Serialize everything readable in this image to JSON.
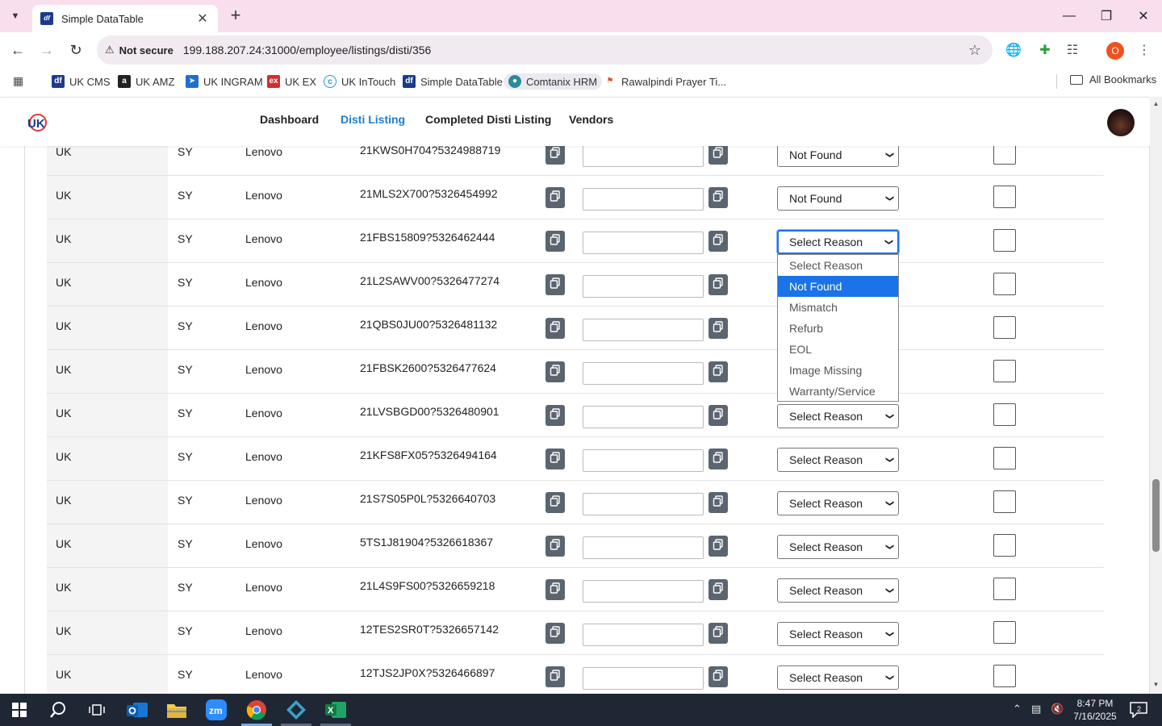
{
  "browser": {
    "tab_title": "Simple DataTable",
    "security_label": "Not secure",
    "url": "199.188.207.24:31000/employee/listings/disti/356",
    "profile_initial": "O",
    "bookmarks": [
      "UK CMS",
      "UK AMZ",
      "UK INGRAM",
      "UK EX",
      "UK InTouch",
      "Simple DataTable",
      "Comtanix HRM",
      "Rawalpindi Prayer Ti..."
    ],
    "all_bookmarks": "All Bookmarks"
  },
  "nav": {
    "links": [
      "Dashboard",
      "Disti Listing",
      "Completed Disti Listing",
      "Vendors"
    ],
    "active": "Disti Listing"
  },
  "table": {
    "rows": [
      {
        "region": "UK",
        "code": "SY",
        "brand": "Lenovo",
        "product": "21KWS0H704?5324988719",
        "reason": "Not Found"
      },
      {
        "region": "UK",
        "code": "SY",
        "brand": "Lenovo",
        "product": "21MLS2X700?5326454992",
        "reason": "Not Found"
      },
      {
        "region": "UK",
        "code": "SY",
        "brand": "Lenovo",
        "product": "21FBS15809?5326462444",
        "reason": "Select Reason"
      },
      {
        "region": "UK",
        "code": "SY",
        "brand": "Lenovo",
        "product": "21L2SAWV00?5326477274",
        "reason": "Select Reason"
      },
      {
        "region": "UK",
        "code": "SY",
        "brand": "Lenovo",
        "product": "21QBS0JU00?5326481132",
        "reason": "Select Reason"
      },
      {
        "region": "UK",
        "code": "SY",
        "brand": "Lenovo",
        "product": "21FBSK2600?5326477624",
        "reason": "Select Reason"
      },
      {
        "region": "UK",
        "code": "SY",
        "brand": "Lenovo",
        "product": "21LVSBGD00?5326480901",
        "reason": "Select Reason"
      },
      {
        "region": "UK",
        "code": "SY",
        "brand": "Lenovo",
        "product": "21KFS8FX05?5326494164",
        "reason": "Select Reason"
      },
      {
        "region": "UK",
        "code": "SY",
        "brand": "Lenovo",
        "product": "21S7S05P0L?5326640703",
        "reason": "Select Reason"
      },
      {
        "region": "UK",
        "code": "SY",
        "brand": "Lenovo",
        "product": "5TS1J81904?5326618367",
        "reason": "Select Reason"
      },
      {
        "region": "UK",
        "code": "SY",
        "brand": "Lenovo",
        "product": "21L4S9FS00?5326659218",
        "reason": "Select Reason"
      },
      {
        "region": "UK",
        "code": "SY",
        "brand": "Lenovo",
        "product": "12TES2SR0T?5326657142",
        "reason": "Select Reason"
      },
      {
        "region": "UK",
        "code": "SY",
        "brand": "Lenovo",
        "product": "12TJS2JP0X?5326466897",
        "reason": "Select Reason"
      }
    ]
  },
  "dropdown": {
    "options": [
      "Select Reason",
      "Not Found",
      "Mismatch",
      "Refurb",
      "EOL",
      "Image Missing",
      "Warranty/Service"
    ],
    "highlighted": "Not Found"
  },
  "taskbar": {
    "time": "8:47 PM",
    "date": "7/16/2025",
    "notification_count": "2"
  }
}
